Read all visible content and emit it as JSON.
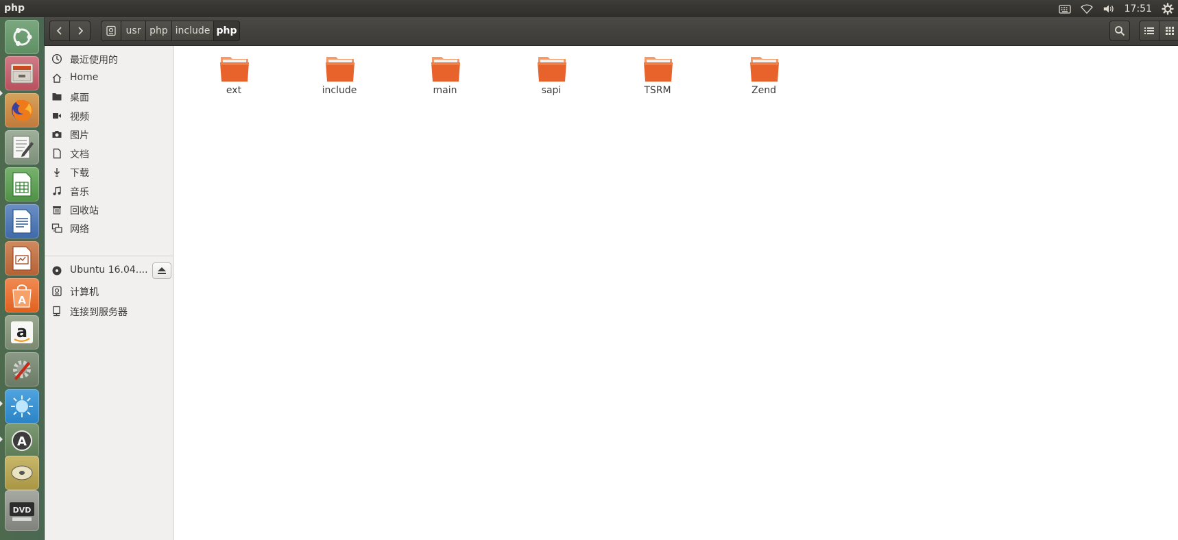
{
  "top_panel": {
    "window_title": "php",
    "clock": "17:51",
    "indicators": [
      "keyboard-icon",
      "wifi-icon",
      "volume-icon",
      "gear-icon"
    ]
  },
  "launcher": {
    "apps": [
      "ubuntu-dash",
      "files",
      "firefox",
      "text-editor",
      "libreoffice-calc",
      "libreoffice-writer",
      "libreoffice-impress",
      "ubuntu-software",
      "amazon",
      "system-settings",
      "screenshot",
      "software-updater",
      "dvd"
    ]
  },
  "headerbar": {
    "path": [
      "usr",
      "php",
      "include",
      "php"
    ],
    "active_index": 3
  },
  "sidebar": {
    "places": [
      {
        "label": "最近使用的",
        "icon": "clock-icon"
      },
      {
        "label": "Home",
        "icon": "home-icon"
      },
      {
        "label": "桌面",
        "icon": "desktop-icon"
      },
      {
        "label": "视频",
        "icon": "video-icon"
      },
      {
        "label": "图片",
        "icon": "camera-icon"
      },
      {
        "label": "文档",
        "icon": "document-icon"
      },
      {
        "label": "下载",
        "icon": "download-icon"
      },
      {
        "label": "音乐",
        "icon": "music-icon"
      },
      {
        "label": "回收站",
        "icon": "trash-icon"
      },
      {
        "label": "网络",
        "icon": "network-icon"
      }
    ],
    "devices": [
      {
        "label": "Ubuntu 16.04....",
        "icon": "disc-icon"
      },
      {
        "label": "计算机",
        "icon": "computer-icon"
      },
      {
        "label": "连接到服务器",
        "icon": "server-icon"
      }
    ]
  },
  "content": {
    "folders": [
      "ext",
      "include",
      "main",
      "sapi",
      "TSRM",
      "Zend"
    ]
  },
  "colors": {
    "accent_orange": "#e95420",
    "folder_top": "#f39a6a",
    "folder_body": "#e8632b"
  }
}
